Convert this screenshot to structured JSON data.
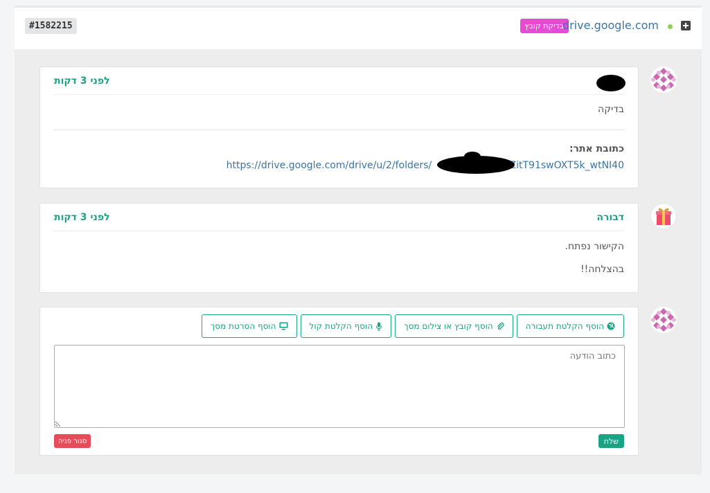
{
  "header": {
    "ticket_id": "#1582215",
    "domain": "drive.google.com",
    "tag": "בדיקת קובץ",
    "status_color": "#8fd14f"
  },
  "messages": [
    {
      "author": "",
      "author_redacted": true,
      "time": "לפני 3 דקות",
      "body": "בדיקה",
      "site_label": "כתובת אתר:",
      "url_left": "https://drive.google.com/drive/u/2/folders/",
      "url_right": "vZitT91swOXT5k_wtNI40",
      "url_middle_redacted": true
    },
    {
      "author": "דבורה",
      "time": "לפני 3 דקות",
      "lines": [
        "הקישור נפתח.",
        "בהצלחה!!"
      ]
    }
  ],
  "composer": {
    "buttons": [
      {
        "label": "הוסף הקלטת תעבורה",
        "icon": "globe-icon"
      },
      {
        "label": "הוסף קובץ או צילום מסך",
        "icon": "paperclip-icon"
      },
      {
        "label": "הוסף הקלטת קול",
        "icon": "microphone-icon"
      },
      {
        "label": "הוסף הסרטת מסך",
        "icon": "monitor-icon"
      }
    ],
    "placeholder": "כתוב הודעה",
    "send_label": "שלח",
    "close_label": "סגור פניה"
  },
  "colors": {
    "accent": "#1aa384",
    "tag": "#e54bd6",
    "close": "#e74c5a",
    "link": "#3a75a8"
  }
}
